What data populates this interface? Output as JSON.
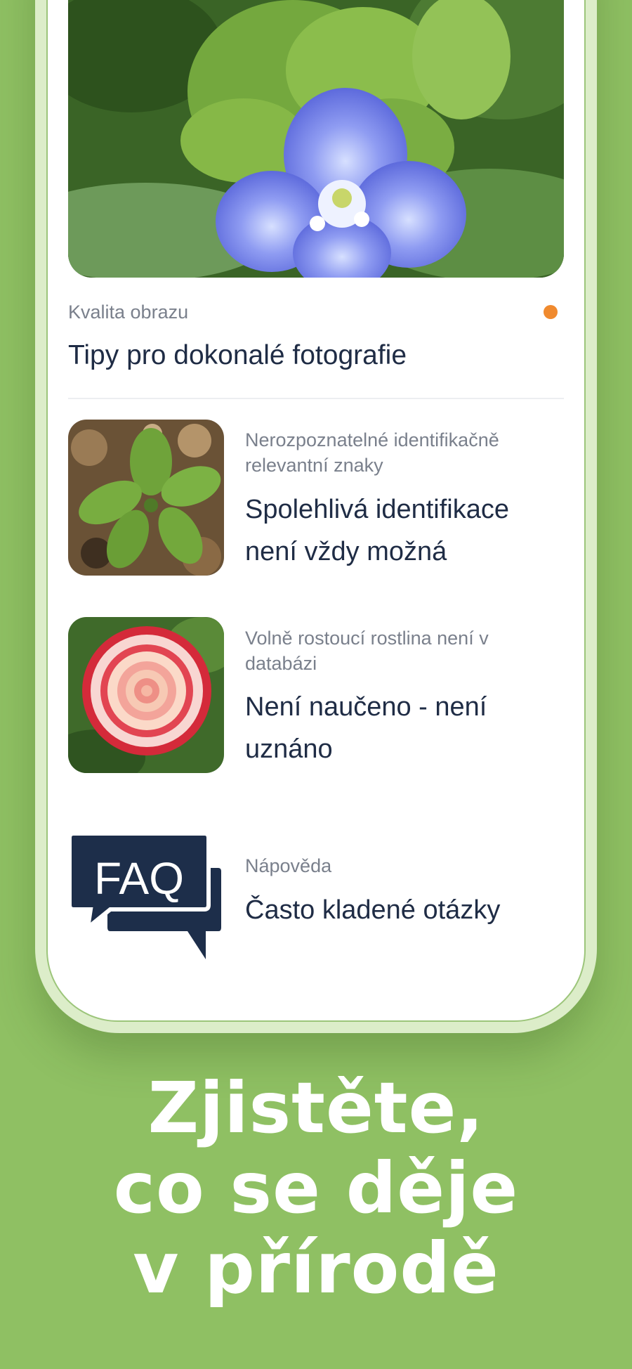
{
  "articles": {
    "hero": {
      "category": "Kvalita obrazu",
      "title": "Tipy pro dokonalé fotografie",
      "unread": true,
      "unread_color": "#f08a2e"
    },
    "items": [
      {
        "category": "Nerozpoznatelné identifikačně relevantní znaky",
        "title": "Spolehlivá identifikace není vždy možná"
      },
      {
        "category": "Volně rostoucí rostlina není v databázi",
        "title": "Není naučeno - není uznáno"
      },
      {
        "category": "Nápověda",
        "title": "Často kladené otázky",
        "icon_text": "FAQ"
      }
    ]
  },
  "slogan": {
    "line1": "Zjistěte,",
    "line2": "co se děje",
    "line3": "v přírodě"
  },
  "colors": {
    "background": "#8fc063",
    "title_text": "#1f2c45",
    "faq_icon": "#1d2e4a"
  }
}
